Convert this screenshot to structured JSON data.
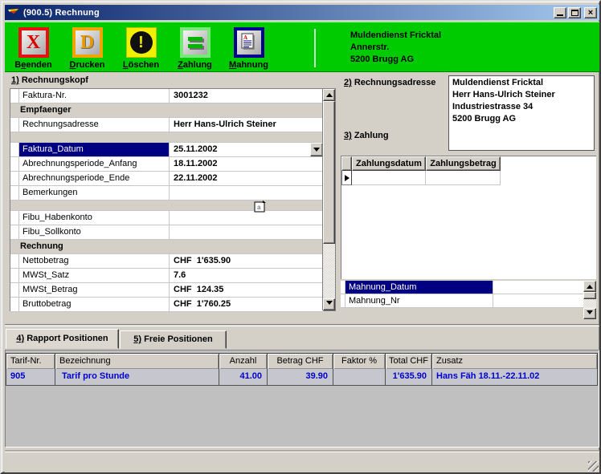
{
  "window": {
    "title": "(900.5) Rechnung"
  },
  "colors": {
    "toolbar_green": "#00cb00",
    "title_left": "#0a246a",
    "title_right": "#a6caf0",
    "panel_bg": "#d4d0c8",
    "table_bg": "#c0c0c0",
    "selection": "#000080",
    "row_blue": "#0000cc"
  },
  "toolbar": {
    "buttons": [
      {
        "icon": "exit-x-icon",
        "glyph": "X",
        "pre": "B",
        "key": "e",
        "post": "enden"
      },
      {
        "icon": "print-d-icon",
        "glyph": "D",
        "pre": "",
        "key": "D",
        "post": "rucken"
      },
      {
        "icon": "warning-exclamation-icon",
        "glyph": "!",
        "pre": "",
        "key": "L",
        "post": "öschen"
      },
      {
        "icon": "equals-payment-icon",
        "pre": "",
        "key": "Z",
        "post": "ahlung"
      },
      {
        "icon": "document-reminder-icon",
        "pre": "",
        "key": "M",
        "post": "ahnung"
      }
    ],
    "company_lines": [
      "Muldendienst Fricktal",
      "Annerstr.",
      "5200 Brugg AG"
    ]
  },
  "rechnungskopf": {
    "num": "1)",
    "title": " Rechnungskopf",
    "rows": [
      {
        "type": "field",
        "label": "Faktura-Nr.",
        "value": "3001232"
      },
      {
        "type": "section",
        "label": "Empfaenger"
      },
      {
        "type": "field",
        "label": "Rechnungsadresse",
        "value": "Herr Hans-Ulrich Steiner"
      },
      {
        "type": "spacer"
      },
      {
        "type": "field",
        "label": "Faktura_Datum",
        "value": "25.11.2002",
        "selected": true,
        "dropdown": true
      },
      {
        "type": "field",
        "label": "Abrechnungsperiode_Anfang",
        "value": "18.11.2002"
      },
      {
        "type": "field",
        "label": "Abrechnungsperiode_Ende",
        "value": "22.11.2002"
      },
      {
        "type": "field",
        "label": "Bemerkungen",
        "value": "",
        "memo": true
      },
      {
        "type": "spacer"
      },
      {
        "type": "field",
        "label": "Fibu_Habenkonto",
        "value": ""
      },
      {
        "type": "field",
        "label": "Fibu_Sollkonto",
        "value": ""
      },
      {
        "type": "section",
        "label": "Rechnung"
      },
      {
        "type": "field",
        "label": "Nettobetrag",
        "value": "CHF  1'635.90"
      },
      {
        "type": "field",
        "label": "MWSt_Satz",
        "value": "7.6"
      },
      {
        "type": "field",
        "label": "MWSt_Betrag",
        "value": "CHF  124.35"
      },
      {
        "type": "field",
        "label": "Bruttobetrag",
        "value": "CHF  1'760.25"
      }
    ]
  },
  "rechnungsadresse": {
    "num": "2)",
    "title": " Rechnungsadresse",
    "lines": [
      "Muldendienst Fricktal",
      "Herr Hans-Ulrich Steiner",
      "Industriestrasse 34",
      "5200 Brugg AG"
    ]
  },
  "zahlung": {
    "num": "3)",
    "title": " Zahlung",
    "headers": [
      "Zahlungsdatum",
      "Zahlungsbetrag"
    ],
    "rows": [
      {
        "datum": "",
        "betrag": ""
      }
    ]
  },
  "mahnung": {
    "rows": [
      {
        "label": "Mahnung_Datum",
        "value": "",
        "selected": true
      },
      {
        "label": "Mahnung_Nr",
        "value": ""
      }
    ]
  },
  "tabs": [
    {
      "num": "4)",
      "label": " Rapport Positionen",
      "active": true
    },
    {
      "num": "5)",
      "label": " Freie Positionen",
      "active": false
    }
  ],
  "positionen": {
    "headers": [
      "Tarif-Nr.",
      "Bezeichnung",
      "Anzahl",
      "Betrag CHF",
      "Faktor %",
      "Total CHF",
      "Zusatz"
    ],
    "rows": [
      [
        "905",
        "Tarif pro Stunde",
        "41.00",
        "39.90",
        "",
        "1'635.90",
        "Hans Fäh 18.11.-22.11.02"
      ]
    ]
  }
}
